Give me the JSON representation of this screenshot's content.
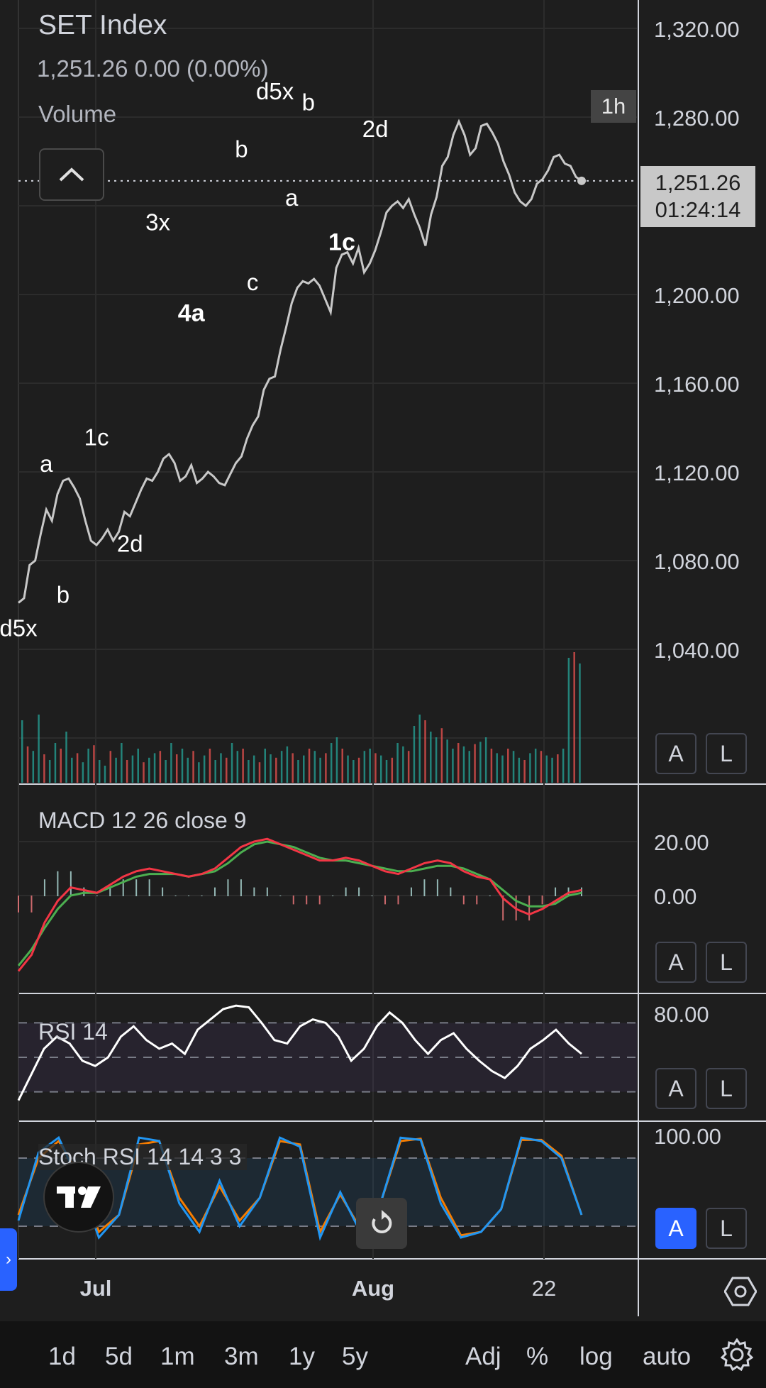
{
  "legend": {
    "title": "SET Index",
    "quote": "1,251.26  0.00 (0.00%)",
    "volume_label": "Volume"
  },
  "timeframe_badge": "1h",
  "last_price": {
    "price": "1,251.26",
    "countdown": "01:24:14"
  },
  "price_axis": {
    "ticks": [
      "1,320.00",
      "1,280.00",
      "1,200.00",
      "1,160.00",
      "1,120.00",
      "1,080.00",
      "1,040.00"
    ]
  },
  "macd": {
    "title": "MACD  12 26 close 9",
    "ticks": [
      "20.00",
      "0.00"
    ]
  },
  "rsi": {
    "title": "RSI  14",
    "ticks": [
      "80.00"
    ]
  },
  "stoch": {
    "title": "Stoch RSI  14 14 3 3",
    "ticks": [
      "100.00"
    ]
  },
  "time_axis": {
    "labels": [
      "Jul",
      "Aug",
      "22"
    ]
  },
  "scale_buttons": {
    "a": "A",
    "l": "L"
  },
  "toolbar": {
    "ranges": [
      "1d",
      "5d",
      "1m",
      "3m",
      "1y",
      "5y"
    ],
    "adj": "Adj",
    "percent": "%",
    "log": "log",
    "auto": "auto"
  },
  "icons": {
    "collapse": "chevron-up-icon",
    "settings": "gear-icon",
    "reset": "reset-icon",
    "logo": "tradingview-logo",
    "axis": "hexagon-icon"
  },
  "colors": {
    "bg": "#1e1e1e",
    "price_line": "#c8c8c8",
    "macd_line": "#f23645",
    "signal_line": "#4caf50",
    "rsi_line": "#ffffff",
    "stoch_k": "#2196f3",
    "stoch_d": "#f57c00",
    "vol_up": "#26a69a",
    "vol_down": "#ef5350"
  },
  "chart_data": {
    "type": "line",
    "title": "SET Index",
    "price_series": {
      "name": "SET Index",
      "interval": "1h",
      "y": [
        1061,
        1063,
        1078,
        1080,
        1092,
        1103,
        1098,
        1110,
        1116,
        1117,
        1113,
        1108,
        1098,
        1089,
        1087,
        1090,
        1094,
        1089,
        1093,
        1102,
        1100,
        1106,
        1112,
        1117,
        1116,
        1120,
        1126,
        1128,
        1124,
        1116,
        1118,
        1123,
        1115,
        1117,
        1120,
        1118,
        1115,
        1114,
        1119,
        1124,
        1127,
        1135,
        1141,
        1145,
        1157,
        1162,
        1163,
        1175,
        1185,
        1196,
        1203,
        1206,
        1205,
        1207,
        1204,
        1198,
        1192,
        1212,
        1218,
        1219,
        1214,
        1221,
        1210,
        1214,
        1220,
        1228,
        1237,
        1240,
        1242,
        1239,
        1243,
        1236,
        1230,
        1222,
        1236,
        1244,
        1258,
        1262,
        1272,
        1278,
        1272,
        1263,
        1266,
        1276,
        1277,
        1273,
        1268,
        1260,
        1254,
        1246,
        1242,
        1240,
        1243,
        1250,
        1252,
        1256,
        1262,
        1263,
        1259,
        1258,
        1253,
        1251.26
      ]
    },
    "volume": {
      "values": [
        55,
        32,
        28,
        60,
        25,
        20,
        35,
        30,
        45,
        22,
        26,
        18,
        30,
        33,
        20,
        15,
        28,
        22,
        35,
        20,
        24,
        30,
        18,
        22,
        26,
        28,
        20,
        35,
        25,
        30,
        22,
        28,
        18,
        24,
        30,
        20,
        26,
        22,
        35,
        28,
        30,
        20,
        24,
        18,
        30,
        25,
        22,
        28,
        32,
        26,
        20,
        24,
        30,
        28,
        22,
        26,
        35,
        40,
        30,
        24,
        20,
        22,
        28,
        30,
        26,
        24,
        20,
        22,
        35,
        32,
        28,
        50,
        60,
        55,
        45,
        40,
        48,
        38,
        30,
        35,
        32,
        28,
        34,
        36,
        40,
        30,
        26,
        24,
        30,
        28,
        22,
        20,
        26,
        30,
        28,
        24,
        22,
        25,
        30,
        110,
        115,
        105
      ]
    },
    "annotations": [
      {
        "text": "d5x",
        "x": 0,
        "y": 1046,
        "bold": false
      },
      {
        "text": "a",
        "x": 5,
        "y": 1120,
        "bold": false
      },
      {
        "text": "b",
        "x": 8,
        "y": 1061,
        "bold": false
      },
      {
        "text": "1c",
        "x": 14,
        "y": 1132,
        "bold": false
      },
      {
        "text": "2d",
        "x": 20,
        "y": 1084,
        "bold": false
      },
      {
        "text": "3x",
        "x": 25,
        "y": 1229,
        "bold": false
      },
      {
        "text": "4a",
        "x": 31,
        "y": 1188,
        "bold": true
      },
      {
        "text": "b",
        "x": 40,
        "y": 1262,
        "bold": false
      },
      {
        "text": "c",
        "x": 42,
        "y": 1202,
        "bold": false
      },
      {
        "text": "d5x",
        "x": 46,
        "y": 1288,
        "bold": false
      },
      {
        "text": "b",
        "x": 52,
        "y": 1283,
        "bold": false
      },
      {
        "text": "a",
        "x": 49,
        "y": 1240,
        "bold": false
      },
      {
        "text": "1c",
        "x": 58,
        "y": 1220,
        "bold": true
      },
      {
        "text": "2d",
        "x": 64,
        "y": 1271,
        "bold": false
      }
    ],
    "ylim": [
      1020,
      1330
    ],
    "macd": {
      "macd": [
        -28,
        -22,
        -10,
        -2,
        3,
        2,
        1,
        4,
        7,
        9,
        10,
        9,
        8,
        7,
        8,
        10,
        14,
        18,
        20,
        21,
        19,
        17,
        15,
        13,
        13,
        14,
        13,
        11,
        9,
        8,
        10,
        12,
        13,
        12,
        9,
        7,
        6,
        -1,
        -5,
        -7,
        -5,
        -2,
        1,
        2
      ],
      "signal": [
        -26,
        -20,
        -12,
        -5,
        0,
        1,
        1,
        3,
        5,
        7,
        8,
        8,
        8,
        7,
        8,
        9,
        12,
        16,
        19,
        20,
        19,
        18,
        16,
        14,
        13,
        13,
        12,
        11,
        10,
        9,
        9,
        10,
        11,
        11,
        10,
        8,
        6,
        2,
        -2,
        -4,
        -4,
        -3,
        0,
        1
      ],
      "ylim": [
        -35,
        40
      ]
    },
    "rsi": {
      "values": [
        25,
        40,
        55,
        62,
        58,
        48,
        45,
        50,
        62,
        68,
        60,
        55,
        58,
        52,
        66,
        72,
        78,
        80,
        79,
        70,
        60,
        58,
        68,
        72,
        70,
        62,
        48,
        55,
        68,
        76,
        70,
        60,
        52,
        60,
        64,
        55,
        48,
        42,
        38,
        45,
        55,
        60,
        66,
        58,
        52
      ],
      "upper": 70,
      "lower": 30,
      "ylim": [
        15,
        85
      ]
    },
    "stoch": {
      "k": [
        25,
        85,
        98,
        60,
        10,
        30,
        98,
        95,
        40,
        15,
        60,
        20,
        45,
        98,
        90,
        10,
        50,
        15,
        40,
        98,
        96,
        40,
        10,
        15,
        35,
        98,
        95,
        80,
        30
      ],
      "d": [
        30,
        80,
        95,
        65,
        15,
        30,
        92,
        95,
        45,
        20,
        55,
        25,
        45,
        95,
        92,
        15,
        48,
        18,
        40,
        95,
        97,
        45,
        12,
        15,
        35,
        96,
        96,
        82,
        30
      ],
      "upper": 80,
      "lower": 20,
      "ylim": [
        0,
        100
      ]
    },
    "x_labels": [
      {
        "text": "Jul",
        "x": 0.12
      },
      {
        "text": "Aug",
        "x": 0.58
      },
      {
        "text": "22",
        "x": 0.85
      }
    ]
  }
}
